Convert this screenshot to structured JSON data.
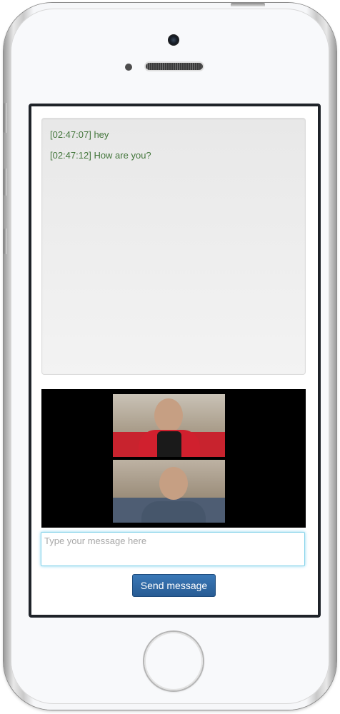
{
  "chat": {
    "messages": [
      {
        "text": "[02:47:07] hey"
      },
      {
        "text": "[02:47:12] How are you?"
      }
    ],
    "message_color": "#43763b"
  },
  "video": {
    "streams": [
      {
        "label": "remote-video"
      },
      {
        "label": "local-video"
      }
    ]
  },
  "composer": {
    "placeholder": "Type your message here",
    "value": "",
    "send_label": "Send message"
  },
  "colors": {
    "button": "#285c94",
    "input_focus": "#86d3ea"
  }
}
